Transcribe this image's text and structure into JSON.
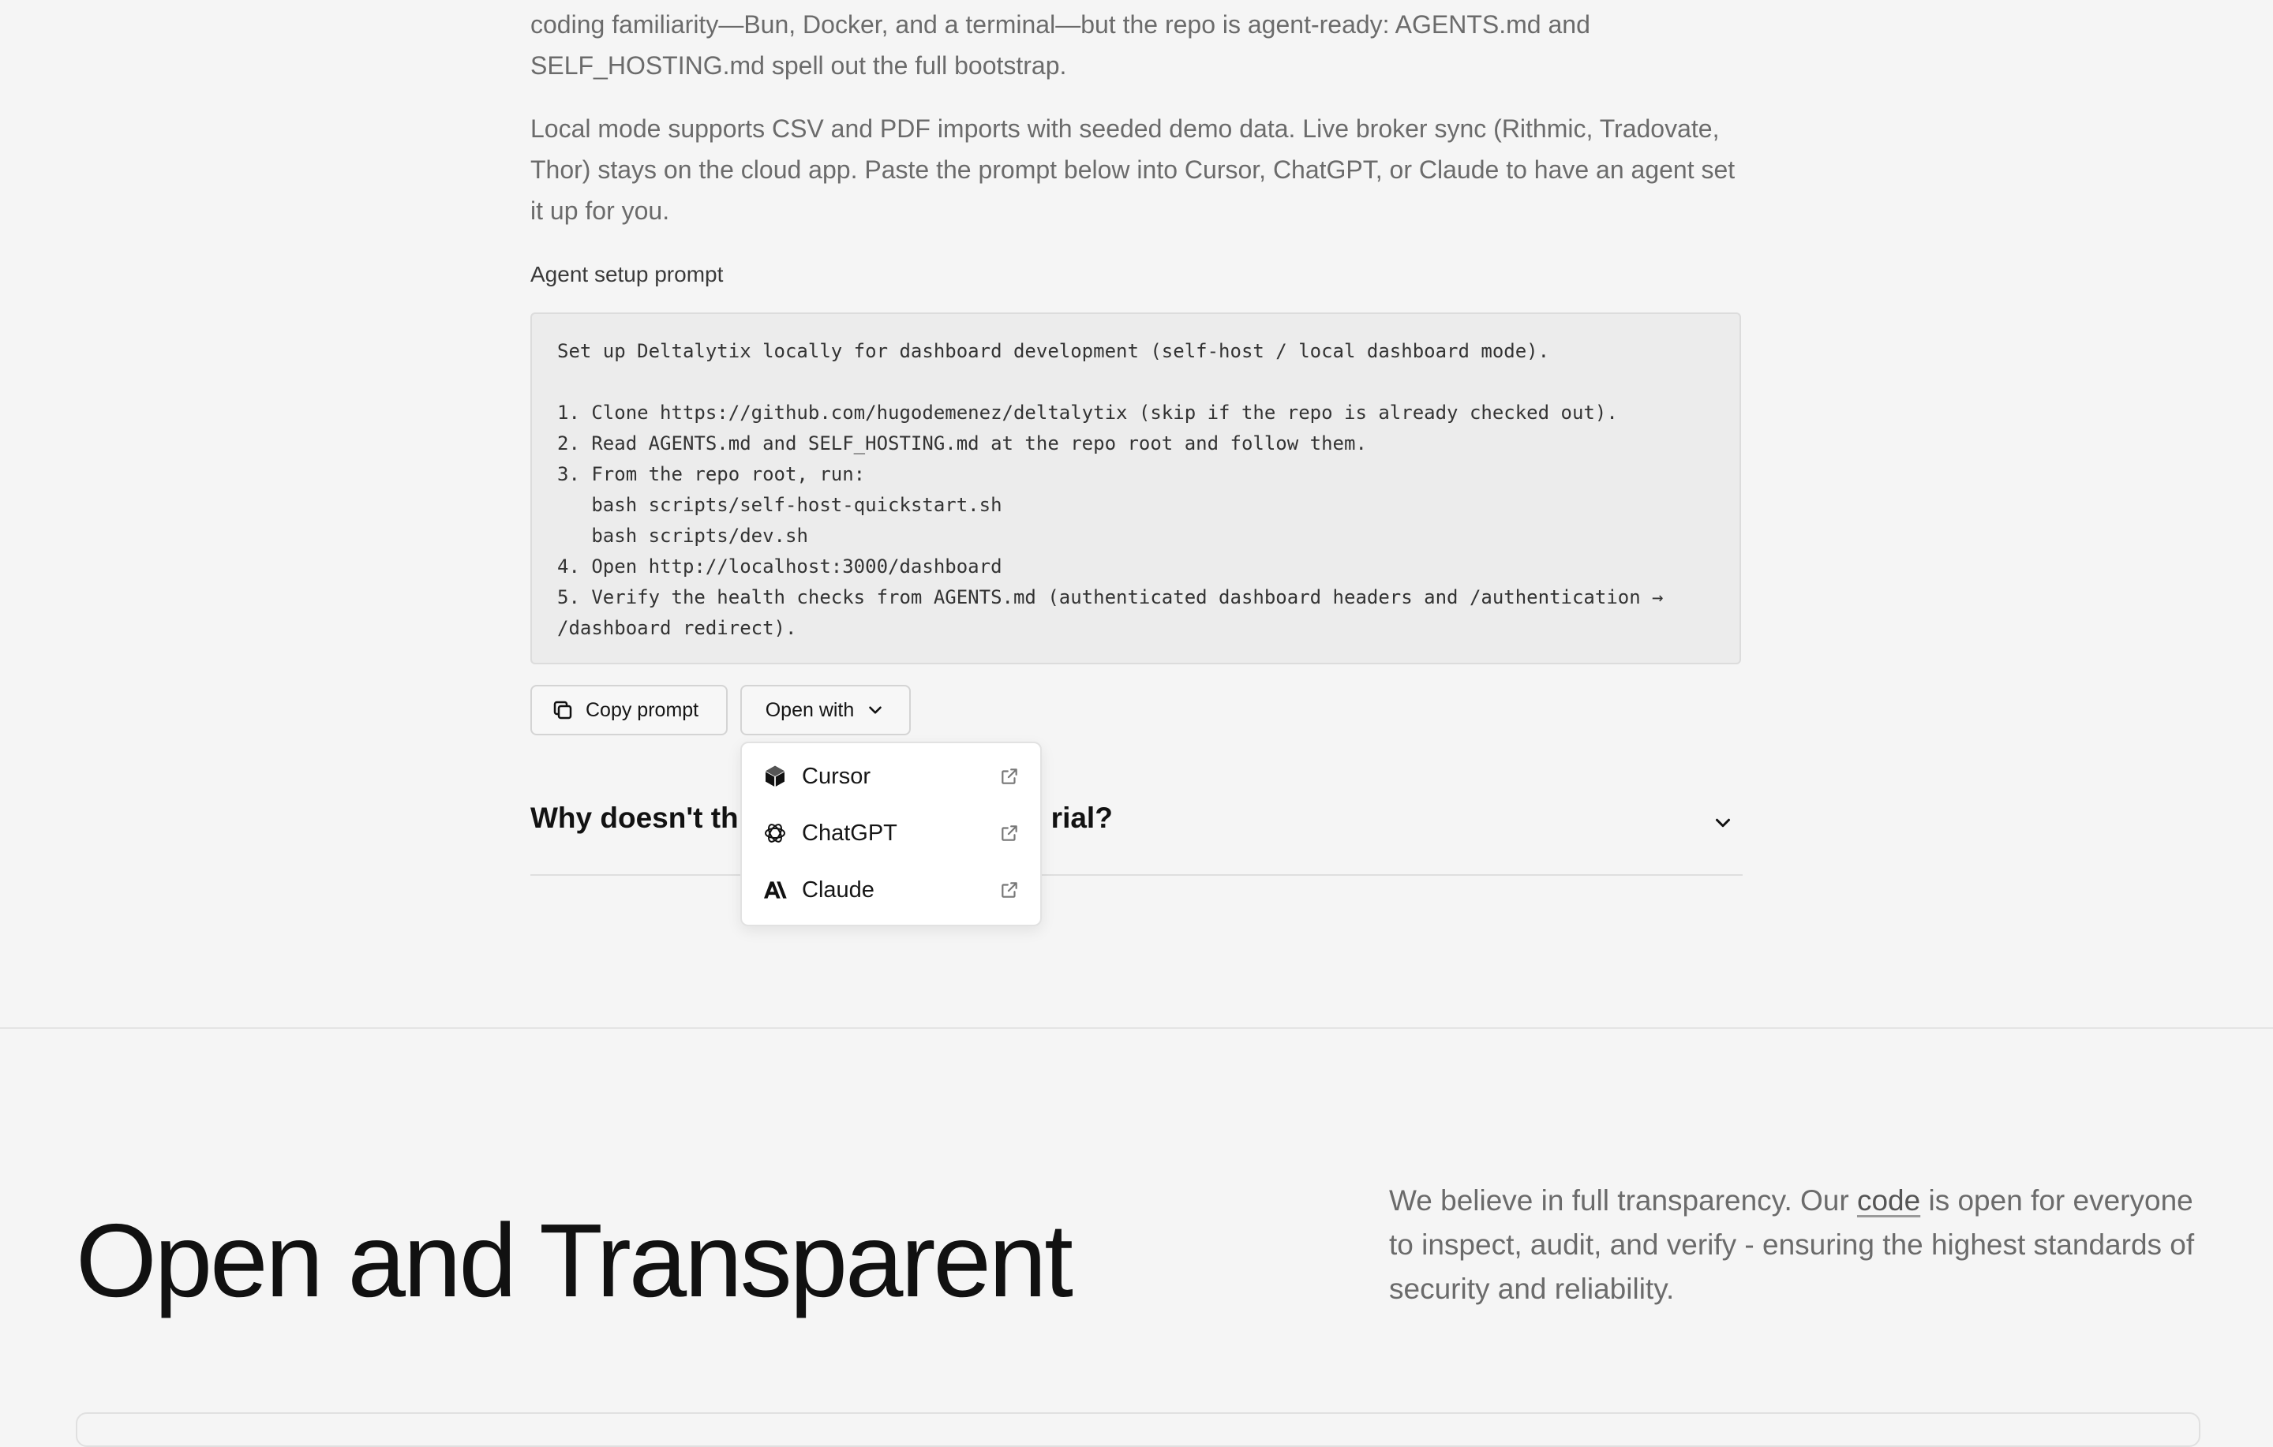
{
  "setup": {
    "para1": "coding familiarity—Bun, Docker, and a terminal—but the repo is agent-ready: AGENTS.md and SELF_HOSTING.md spell out the full bootstrap.",
    "para2": "Local mode supports CSV and PDF imports with seeded demo data. Live broker sync (Rithmic, Tradovate, Thor) stays on the cloud app. Paste the prompt below into Cursor, ChatGPT, or Claude to have an agent set it up for you.",
    "prompt_label": "Agent setup prompt",
    "prompt_text": "Set up Deltalytix locally for dashboard development (self-host / local dashboard mode).\n\n1. Clone https://github.com/hugodemenez/deltalytix (skip if the repo is already checked out).\n2. Read AGENTS.md and SELF_HOSTING.md at the repo root and follow them.\n3. From the repo root, run:\n   bash scripts/self-host-quickstart.sh\n   bash scripts/dev.sh\n4. Open http://localhost:3000/dashboard\n5. Verify the health checks from AGENTS.md (authenticated dashboard headers and /authentication → /dashboard redirect).",
    "copy_label": "Copy prompt",
    "open_with_label": "Open with"
  },
  "dropdown": {
    "items": [
      {
        "label": "Cursor",
        "icon": "cursor-logo-icon"
      },
      {
        "label": "ChatGPT",
        "icon": "chatgpt-logo-icon"
      },
      {
        "label": "Claude",
        "icon": "anthropic-logo-icon"
      }
    ]
  },
  "faq": {
    "question_visible": "Why doesn't th",
    "question_tail": "rial?"
  },
  "hero": {
    "title": "Open and Transparent",
    "text_before": "We believe in full transparency. Our ",
    "text_link": "code",
    "text_after": " is open for everyone to inspect, audit, and verify - ensuring the highest standards of security and reliability."
  },
  "colors": {
    "background": "#f5f5f5",
    "muted_text": "#6b6b6b",
    "code_bg": "#ececec"
  }
}
